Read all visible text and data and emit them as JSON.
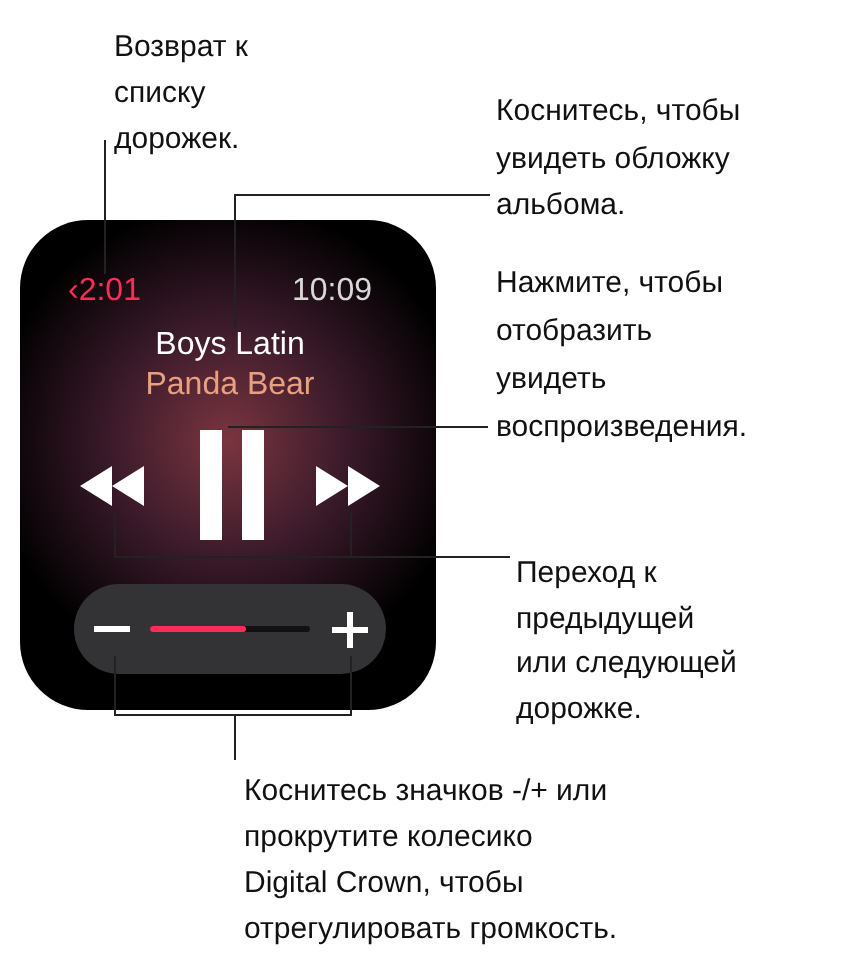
{
  "watch": {
    "back": "‹2:01",
    "time": "10:09",
    "song": "Boys Latin",
    "artist": "Panda Bear",
    "playing": true,
    "volume": {
      "level": 0.6
    }
  },
  "callouts": [
    {
      "text": "Возврат к\nсписку\nдорожек."
    },
    {
      "text": "Коснитесь, чтобы\nувидеть обложку\nальбома."
    },
    {
      "text": "Нажмите, чтобы\nотобразить\nувидеть\nвоспроизведения."
    },
    {
      "text": "Переход к\nпредыдущей\nили следующей\nдорожке."
    },
    {
      "text": "Коснитесь значков -/+ или\nпрокрутите колесико\nDigital Crown, чтобы\nотрегулировать громкость."
    }
  ]
}
